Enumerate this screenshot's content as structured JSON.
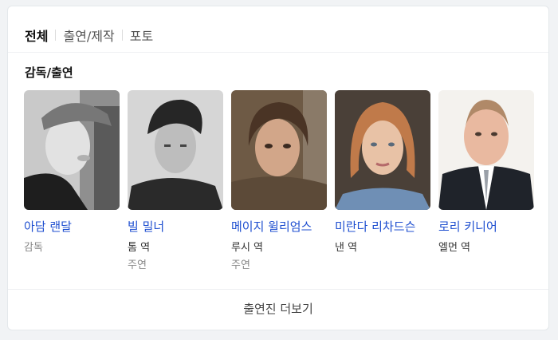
{
  "tabs": [
    {
      "label": "전체",
      "active": true
    },
    {
      "label": "출연/제작",
      "active": false
    },
    {
      "label": "포토",
      "active": false
    }
  ],
  "section_title": "감독/출연",
  "cast": [
    {
      "name": "아담 랜달",
      "role": "감독",
      "sub": "",
      "photo_icon": "person-photo"
    },
    {
      "name": "빌 밀너",
      "role": "톰 역",
      "sub": "주연",
      "photo_icon": "person-photo"
    },
    {
      "name": "메이지 윌리엄스",
      "role": "루시 역",
      "sub": "주연",
      "photo_icon": "person-photo"
    },
    {
      "name": "미란다 리차드슨",
      "role": "낸 역",
      "sub": "",
      "photo_icon": "person-photo"
    },
    {
      "name": "로리 키니어",
      "role": "엘먼 역",
      "sub": "",
      "photo_icon": "person-photo"
    }
  ],
  "more_label": "출연진 더보기",
  "colors": {
    "link": "#1f4fd0",
    "muted": "#888888",
    "background": "#f1f3f5"
  }
}
